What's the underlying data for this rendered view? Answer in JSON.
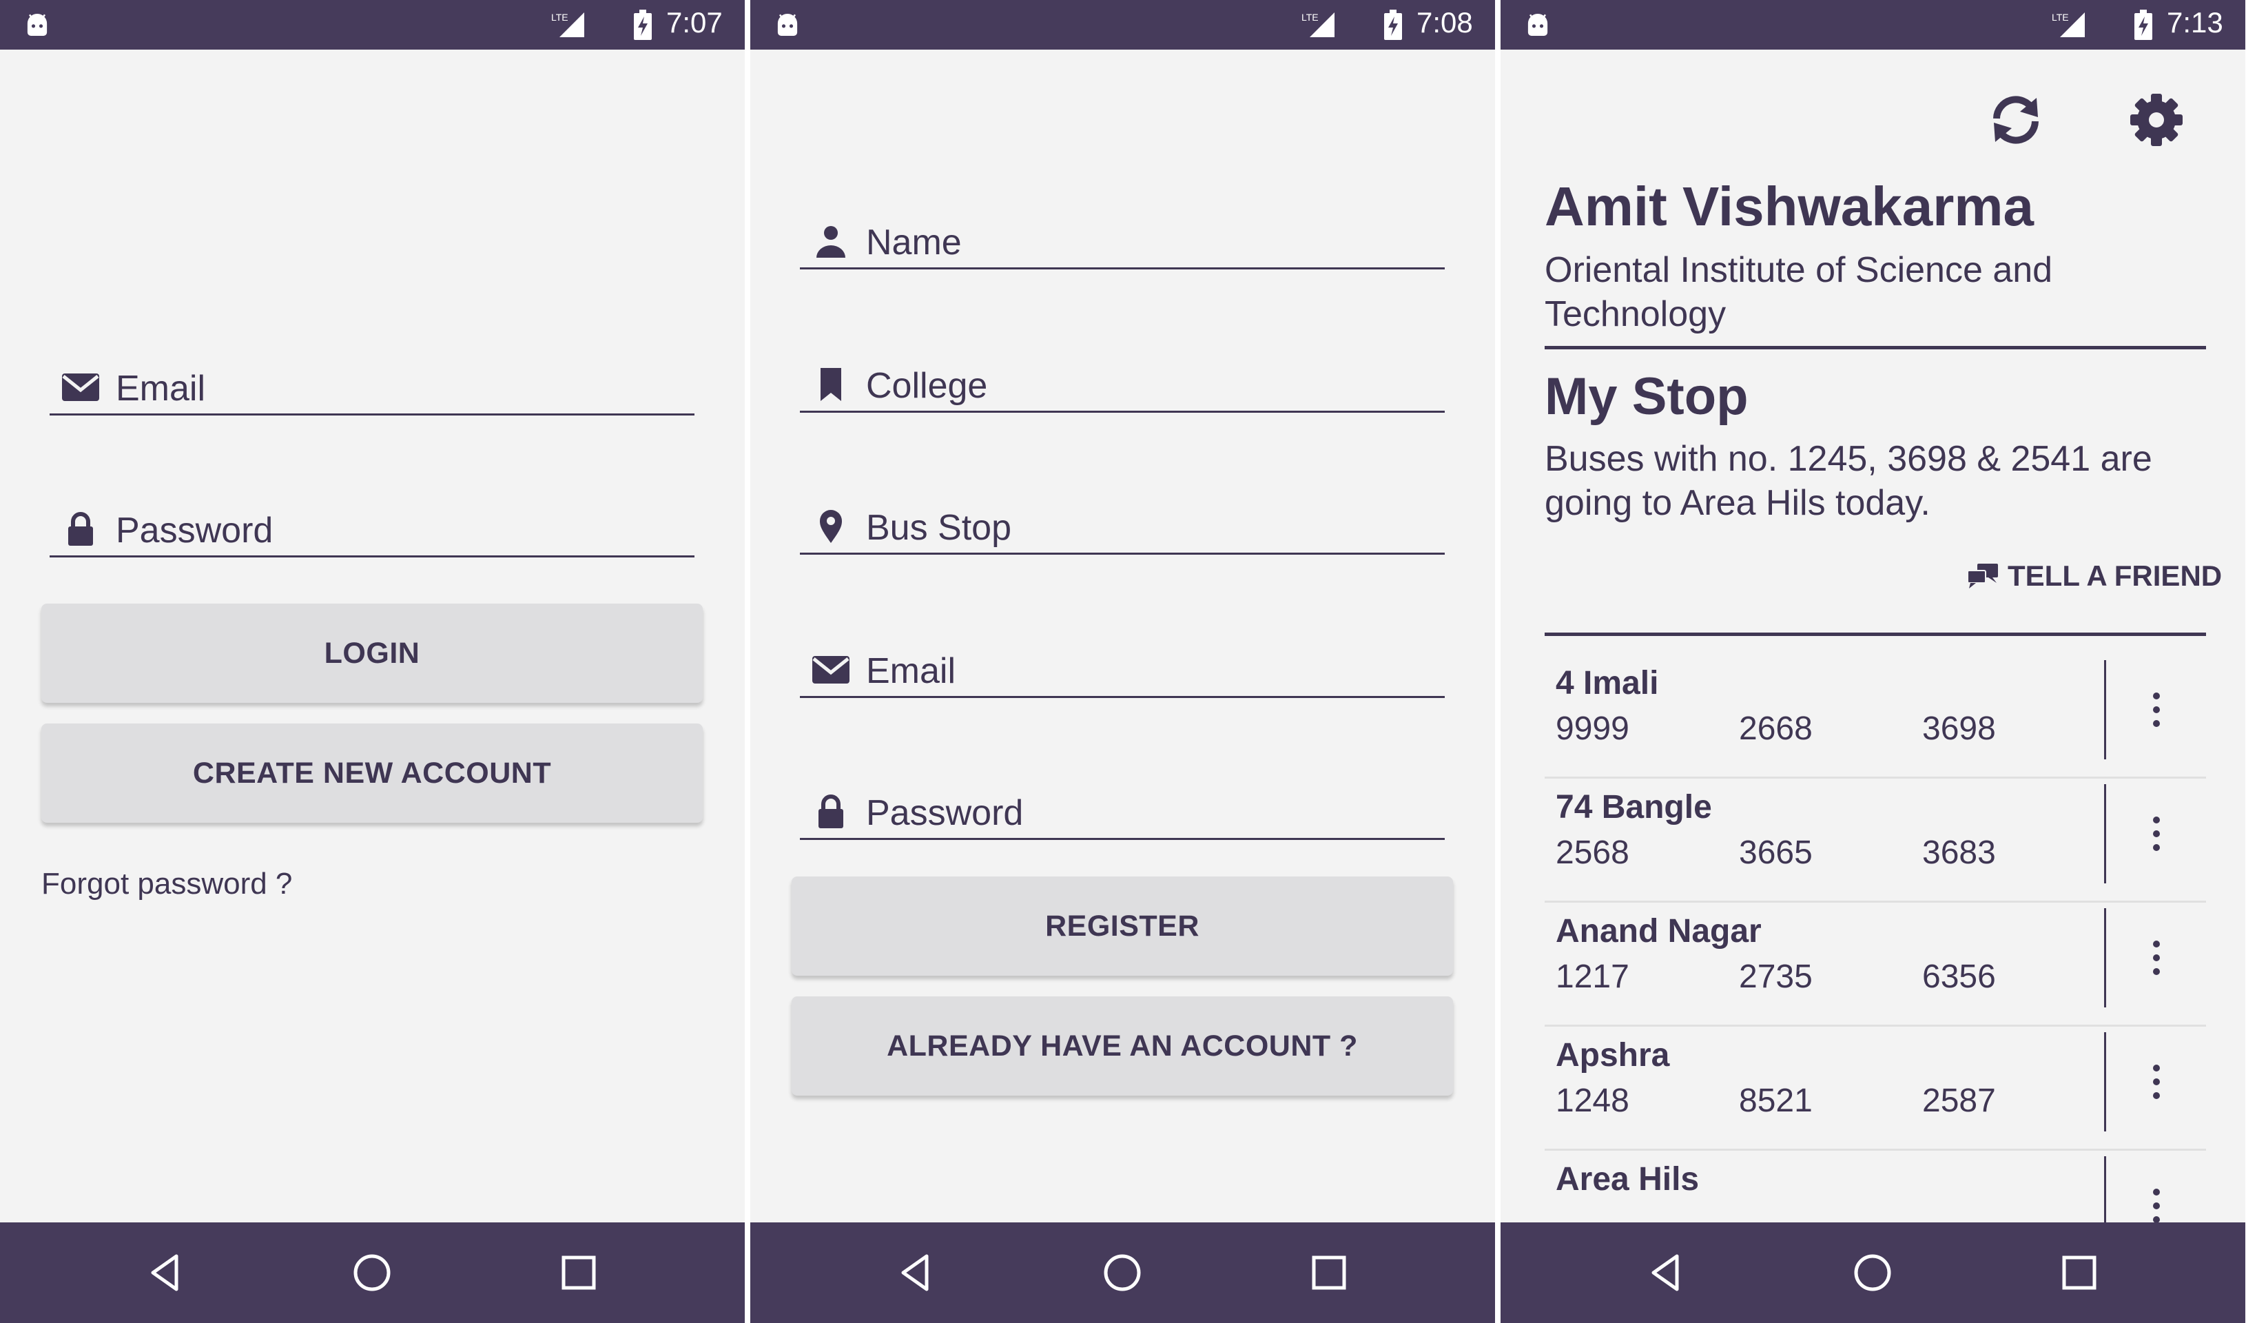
{
  "colors": {
    "primary": "#463b5b",
    "text": "#3f3653",
    "background": "#f3f3f3",
    "button": "#dedee0"
  },
  "login": {
    "status_time": "7:07",
    "email_label": "Email",
    "password_label": "Password",
    "login_button": "LOGIN",
    "create_account_button": "CREATE NEW ACCOUNT",
    "forgot_link": "Forgot password ?"
  },
  "register": {
    "status_time": "7:08",
    "name_label": "Name",
    "college_label": "College",
    "bus_stop_label": "Bus Stop",
    "email_label": "Email",
    "password_label": "Password",
    "register_button": "REGISTER",
    "have_account_button": "ALREADY HAVE AN ACCOUNT ?"
  },
  "home": {
    "status_time": "7:13",
    "user_name": "Amit Vishwakarma",
    "college": "Oriental Institute of Science and Technology",
    "my_stop_title": "My Stop",
    "my_stop_message": "Buses with no. 1245, 3698 & 2541 are going to Area Hils today.",
    "tell_friend": "TELL A FRIEND",
    "stops": [
      {
        "name": "4 Imali",
        "buses": [
          "9999",
          "2668",
          "3698"
        ]
      },
      {
        "name": "74 Bangle",
        "buses": [
          "2568",
          "3665",
          "3683"
        ]
      },
      {
        "name": "Anand Nagar",
        "buses": [
          "1217",
          "2735",
          "6356"
        ]
      },
      {
        "name": "Apshra",
        "buses": [
          "1248",
          "8521",
          "2587"
        ]
      },
      {
        "name": "Area Hils",
        "buses": []
      }
    ]
  },
  "icons": {
    "status": [
      "android-icon",
      "lte-signal-icon",
      "battery-charging-icon"
    ],
    "navigation": [
      "back-icon",
      "home-icon",
      "recent-apps-icon"
    ],
    "fields": [
      "person-icon",
      "bookmark-icon",
      "location-pin-icon",
      "envelope-icon",
      "lock-icon"
    ],
    "toolbar": [
      "refresh-icon",
      "settings-gear-icon"
    ],
    "misc": [
      "chat-bubbles-icon",
      "more-vert-icon"
    ]
  }
}
